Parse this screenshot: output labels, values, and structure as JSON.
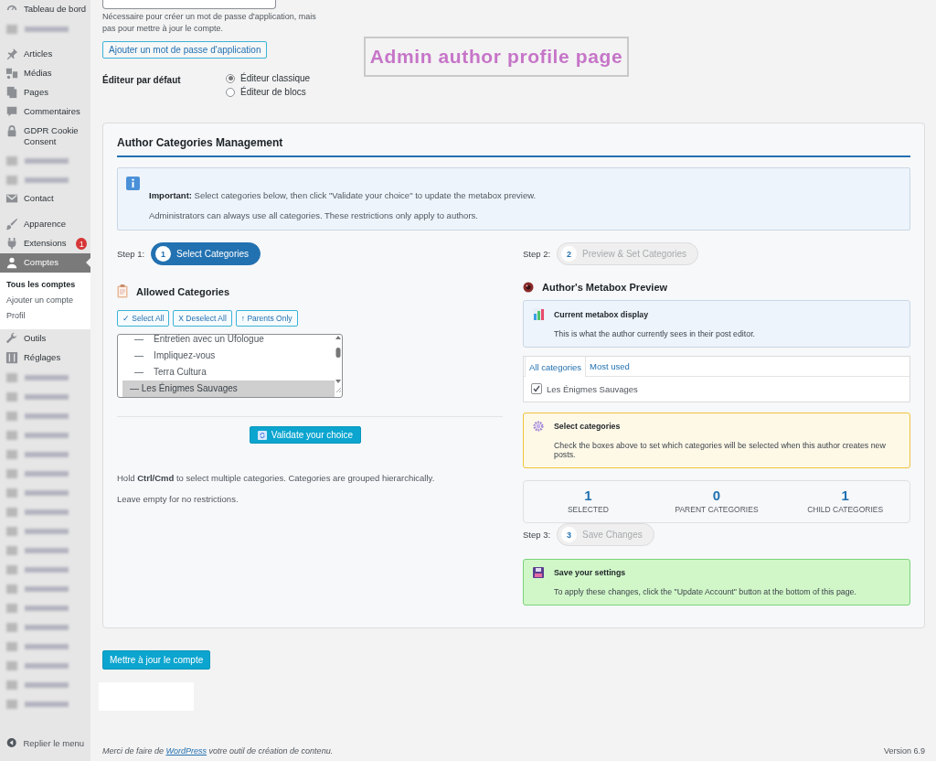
{
  "sidebar": {
    "items": [
      {
        "kind": "item",
        "label": "Tableau de bord",
        "selected": false
      },
      {
        "kind": "blurred"
      },
      {
        "kind": "item",
        "label": "Articles",
        "selected": false
      },
      {
        "kind": "item",
        "label": "Médias",
        "selected": false
      },
      {
        "kind": "item",
        "label": "Pages",
        "selected": false
      },
      {
        "kind": "item",
        "label": "Commentaires",
        "selected": false
      },
      {
        "kind": "item",
        "label": "GDPR Cookie Consent",
        "selected": false
      },
      {
        "kind": "blurred"
      },
      {
        "kind": "blurred"
      },
      {
        "kind": "item",
        "label": "Contact",
        "selected": false
      },
      {
        "kind": "item",
        "label": "Apparence",
        "selected": false
      },
      {
        "kind": "item",
        "label": "Extensions",
        "selected": false,
        "badge": "1"
      },
      {
        "kind": "item",
        "label": "Comptes",
        "selected": true,
        "children": [
          {
            "label": "Tous les comptes",
            "selected": true
          },
          {
            "label": "Ajouter un compte",
            "selected": false
          },
          {
            "label": "Profil",
            "selected": false
          }
        ]
      },
      {
        "kind": "item",
        "label": "Outils",
        "selected": false
      },
      {
        "kind": "item",
        "label": "Réglages",
        "selected": false
      },
      {
        "kind": "blurred"
      },
      {
        "kind": "blurred"
      },
      {
        "kind": "blurred"
      },
      {
        "kind": "blurred"
      },
      {
        "kind": "blurred"
      },
      {
        "kind": "blurred"
      },
      {
        "kind": "blurred"
      },
      {
        "kind": "blurred"
      },
      {
        "kind": "blurred"
      },
      {
        "kind": "blurred"
      },
      {
        "kind": "blurred"
      },
      {
        "kind": "blurred"
      },
      {
        "kind": "blurred"
      },
      {
        "kind": "blurred"
      },
      {
        "kind": "blurred"
      },
      {
        "kind": "blurred"
      },
      {
        "kind": "blurred"
      },
      {
        "kind": "blurred"
      }
    ],
    "collapse": "Replier le menu"
  },
  "app_password": {
    "description": "Nécessaire pour créer un mot de passe d'application, mais pas pour mettre à jour le compte.",
    "button": "Ajouter un mot de passe d'application"
  },
  "annotation": "Admin author profile page",
  "editor": {
    "label": "Éditeur par défaut",
    "options": [
      {
        "label": "Éditeur classique",
        "selected": true
      },
      {
        "label": "Éditeur de blocs",
        "selected": false
      }
    ]
  },
  "categories_card": {
    "title": "Author Categories Management",
    "notice": {
      "lead": "**Important:** Select categories below, then click \"Validate your choice\" to update the metabox preview.",
      "note": "Administrators can always use all categories. These restrictions only apply to authors."
    },
    "steps": [
      {
        "label": "Step 1:",
        "number": "1",
        "title": "Select Categories",
        "active": true
      },
      {
        "label": "Step 2:",
        "number": "2",
        "title": "Preview & Set Categories",
        "active": false
      },
      {
        "label": "Step 3:",
        "number": "3",
        "title": "Save Changes",
        "active": false
      }
    ],
    "allowed": {
      "heading": "Allowed Categories",
      "buttons": [
        "✓ Select All",
        "X Deselect All",
        "↑ Parents Only"
      ],
      "options": [
        {
          "label": "—    Entretien avec un Ufologue",
          "selected": false
        },
        {
          "label": "—    Impliquez-vous",
          "selected": false
        },
        {
          "label": "—    Terra Cultura",
          "selected": false
        },
        {
          "label": "— Les Énigmes Sauvages",
          "selected": true
        }
      ],
      "validate_button": "Validate your choice",
      "hints": [
        "Hold **Ctrl/Cmd** to select multiple categories. Categories are grouped hierarchically.",
        "Leave empty for no restrictions."
      ]
    },
    "preview": {
      "heading": "Author's Metabox Preview",
      "current": {
        "title": "Current metabox display",
        "text": "This is what the author currently sees in their post editor."
      },
      "metabox": {
        "tabs": [
          {
            "label": "All categories",
            "selected": true
          },
          {
            "label": "Most used",
            "selected": false
          }
        ],
        "items": [
          {
            "label": "Les Énigmes Sauvages",
            "checked": true
          }
        ]
      },
      "select_notice": {
        "title": "Select categories",
        "text": "Check the boxes above to set which categories will be selected when this author creates new posts."
      },
      "stats": [
        {
          "value": "1",
          "label": "SELECTED"
        },
        {
          "value": "0",
          "label": "PARENT CATEGORIES"
        },
        {
          "value": "1",
          "label": "CHILD CATEGORIES"
        }
      ],
      "save_notice": {
        "title": "Save your settings",
        "text": "To apply these changes, click the \"Update Account\" button at the bottom of this page."
      }
    }
  },
  "update_button": "Mettre à jour le compte",
  "footer": {
    "before": "Merci de faire de ",
    "link": "WordPress",
    "after": " votre outil de création de contenu.",
    "version": "Version 6.9"
  }
}
